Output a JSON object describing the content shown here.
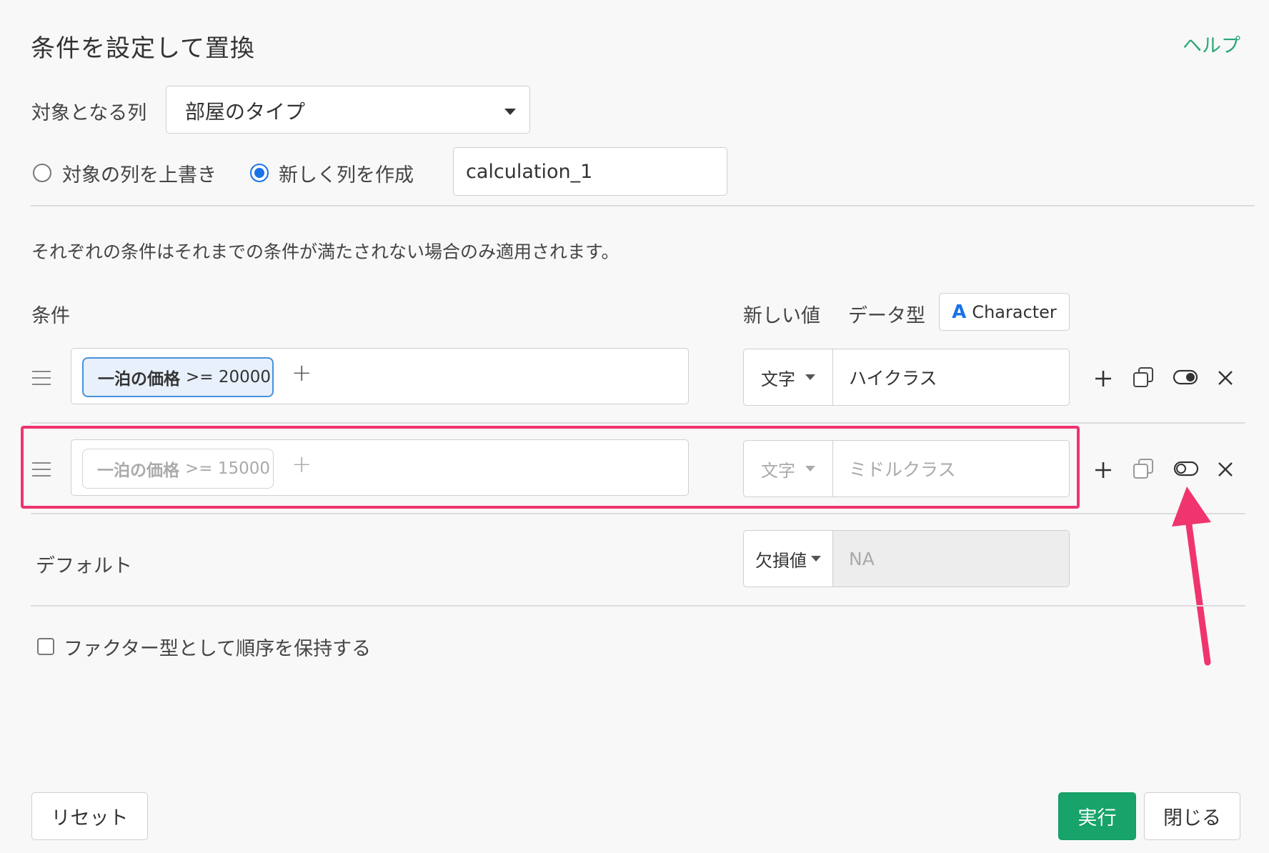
{
  "dialog": {
    "title": "条件を設定して置換",
    "help_label": "ヘルプ"
  },
  "target_column": {
    "label": "対象となる列",
    "selected": "部屋のタイプ"
  },
  "mode": {
    "overwrite_label": "対象の列を上書き",
    "new_column_label": "新しく列を作成",
    "selected": "new_column",
    "new_column_name": "calculation_1"
  },
  "description": "それぞれの条件はそれまでの条件が満たされない場合のみ適用されます。",
  "headers": {
    "condition": "条件",
    "new_value": "新しい値",
    "data_type": "データ型",
    "data_type_value": "Character",
    "data_type_icon": "A"
  },
  "rows": [
    {
      "field": "一泊の価格",
      "expr": ">= 20000",
      "value_type": "文字",
      "value": "ハイクラス",
      "enabled": true
    },
    {
      "field": "一泊の価格",
      "expr": ">= 15000",
      "value_type": "文字",
      "value": "ミドルクラス",
      "enabled": false
    }
  ],
  "default_row": {
    "label": "デフォルト",
    "value_type": "欠損値",
    "value": "NA"
  },
  "factor": {
    "label": "ファクター型として順序を保持する",
    "checked": false
  },
  "buttons": {
    "reset": "リセット",
    "run": "実行",
    "close": "閉じる"
  },
  "colors": {
    "accent": "#17a36a",
    "highlight": "#f0346e",
    "link": "#2aa876",
    "chip_border": "#4a90d9"
  }
}
